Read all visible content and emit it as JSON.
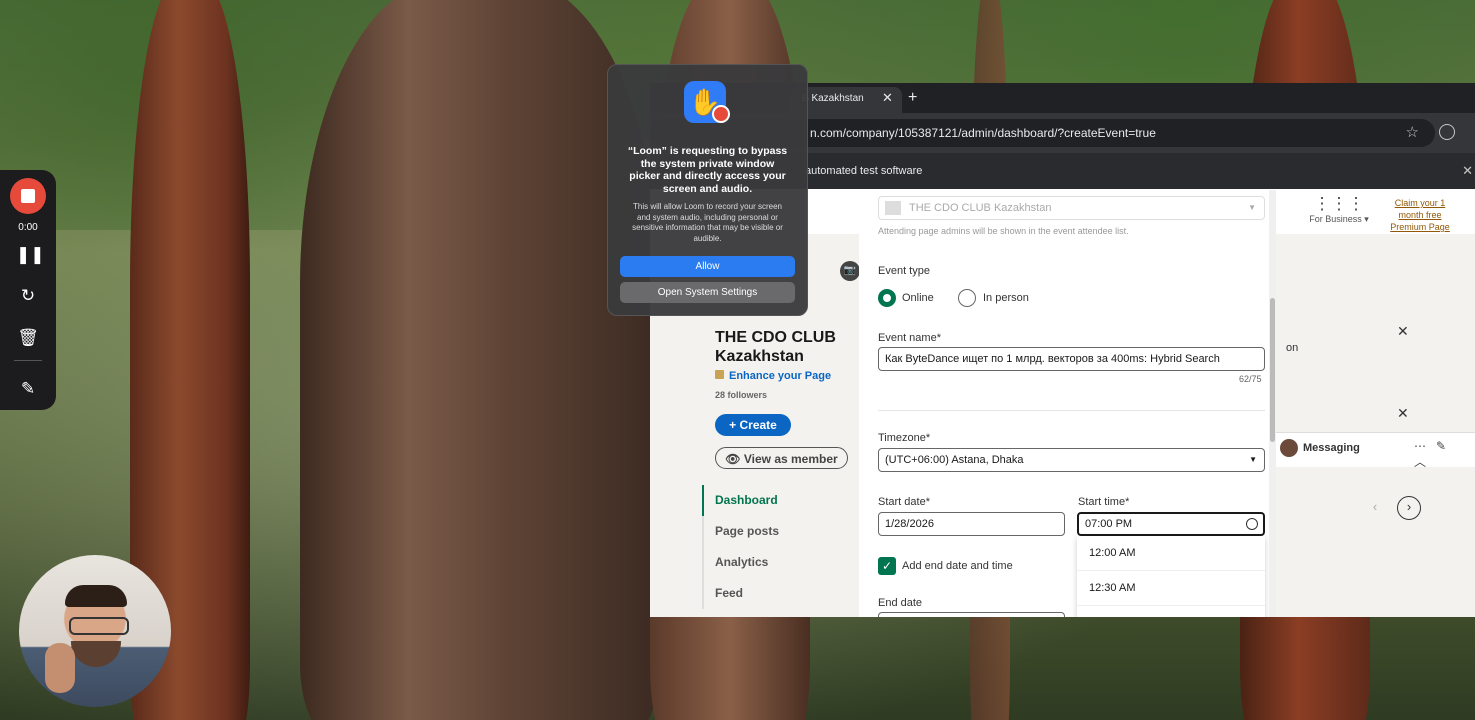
{
  "loom": {
    "timer": "0:00",
    "dialog": {
      "title": "“Loom” is requesting to bypass the system private window picker and directly access your screen and audio.",
      "body": "This will allow Loom to record your screen and system audio, including personal or sensitive information that may be visible or audible.",
      "allow_label": "Allow",
      "settings_label": "Open System Settings"
    }
  },
  "browser": {
    "tab_title": "B Kazakhstan",
    "url": "n.com/company/105387121/admin/dashboard/?createEvent=true",
    "infobar": "automated test software"
  },
  "linkedin": {
    "for_business": "For Business ▾",
    "premium_promo": "Claim your 1 month free Premium Page",
    "page_name": "THE CDO CLUB Kazakhstan",
    "enhance_label": "Enhance your Page",
    "followers": "28 followers",
    "create_label": "Create",
    "view_member_label": "View as member",
    "side_nav": [
      "Dashboard",
      "Page posts",
      "Analytics",
      "Feed"
    ],
    "right_text": "on",
    "messaging_label": "Messaging"
  },
  "event_form": {
    "organizer_value": "THE CDO CLUB Kazakhstan",
    "organizer_hint": "Attending page admins will be shown in the event attendee list.",
    "event_type_label": "Event type",
    "event_type_options": [
      "Online",
      "In person"
    ],
    "event_type_selected": "Online",
    "event_name_label": "Event name*",
    "event_name_value": "Как ByteDance ищет по 1 млрд. векторов за 400ms: Hybrid Search",
    "event_name_counter": "62/75",
    "timezone_label": "Timezone*",
    "timezone_value": "(UTC+06:00) Astana, Dhaka",
    "start_date_label": "Start date*",
    "start_date_value": "1/28/2026",
    "start_time_label": "Start time*",
    "start_time_value": "07:00 PM",
    "add_end_label": "Add end date and time",
    "add_end_checked": true,
    "end_date_label": "End date",
    "time_options": [
      "12:00 AM",
      "12:30 AM"
    ]
  },
  "colors": {
    "linkedin_blue": "#0a66c2",
    "linkedin_green": "#01754f",
    "loom_red": "#e64a3b",
    "mac_blue": "#2a7cf0"
  }
}
